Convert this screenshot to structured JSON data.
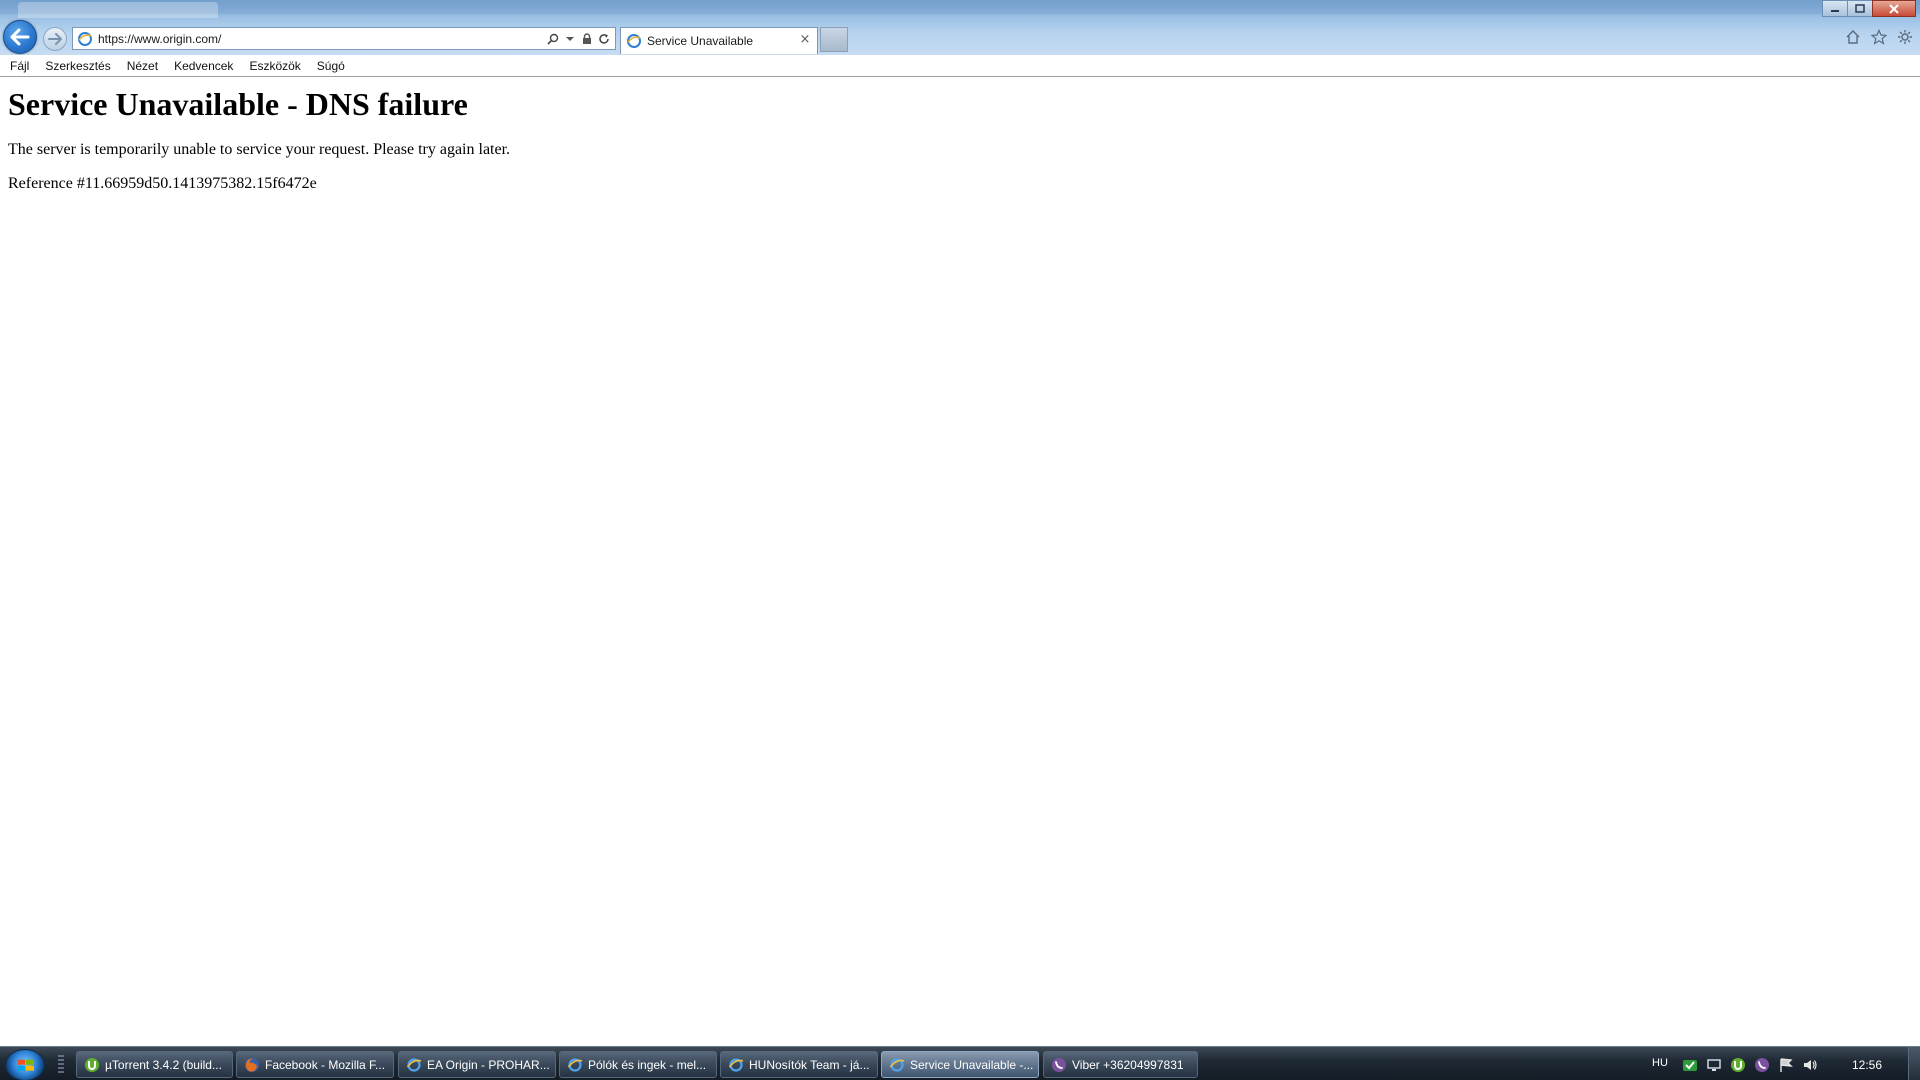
{
  "browser": {
    "address": {
      "url_host": "https://www.origin.com/",
      "url_path": ""
    },
    "tab": {
      "title": "Service Unavailable",
      "close_glyph": "×"
    },
    "icons": [
      "back-arrow-icon",
      "forward-arrow-icon",
      "ie-page-icon",
      "search-icon",
      "dropdown-arrow-icon",
      "lock-icon",
      "refresh-icon",
      "home-icon",
      "favorites-star-icon",
      "gear-icon"
    ],
    "window_buttons": {
      "minimize": "–",
      "maximize": "□",
      "close": "✕"
    }
  },
  "menu": {
    "items": [
      "Fájl",
      "Szerkesztés",
      "Nézet",
      "Kedvencek",
      "Eszközök",
      "Súgó"
    ]
  },
  "page": {
    "heading": "Service Unavailable - DNS failure",
    "message": "The server is temporarily unable to service your request. Please try again later.",
    "reference": "Reference #11.66959d50.1413975382.15f6472e"
  },
  "taskbar": {
    "tasks": [
      {
        "label": "µTorrent 3.4.2  (build...",
        "icon": "utorrent-icon"
      },
      {
        "label": "Facebook - Mozilla F...",
        "icon": "firefox-icon"
      },
      {
        "label": "EA Origin - PROHAR...",
        "icon": "ie-icon"
      },
      {
        "label": "Pólók és ingek - mel...",
        "icon": "ie-icon"
      },
      {
        "label": "HUNosítók Team - já...",
        "icon": "ie-icon"
      },
      {
        "label": "Service Unavailable -...",
        "icon": "ie-icon",
        "active": true
      },
      {
        "label": "Viber +36204997831",
        "icon": "viber-icon"
      }
    ],
    "tray": {
      "language": "HU",
      "clock": "12:56"
    },
    "colors": {
      "accent": "#2b78cf",
      "taskbar": "#1f2a35"
    }
  }
}
